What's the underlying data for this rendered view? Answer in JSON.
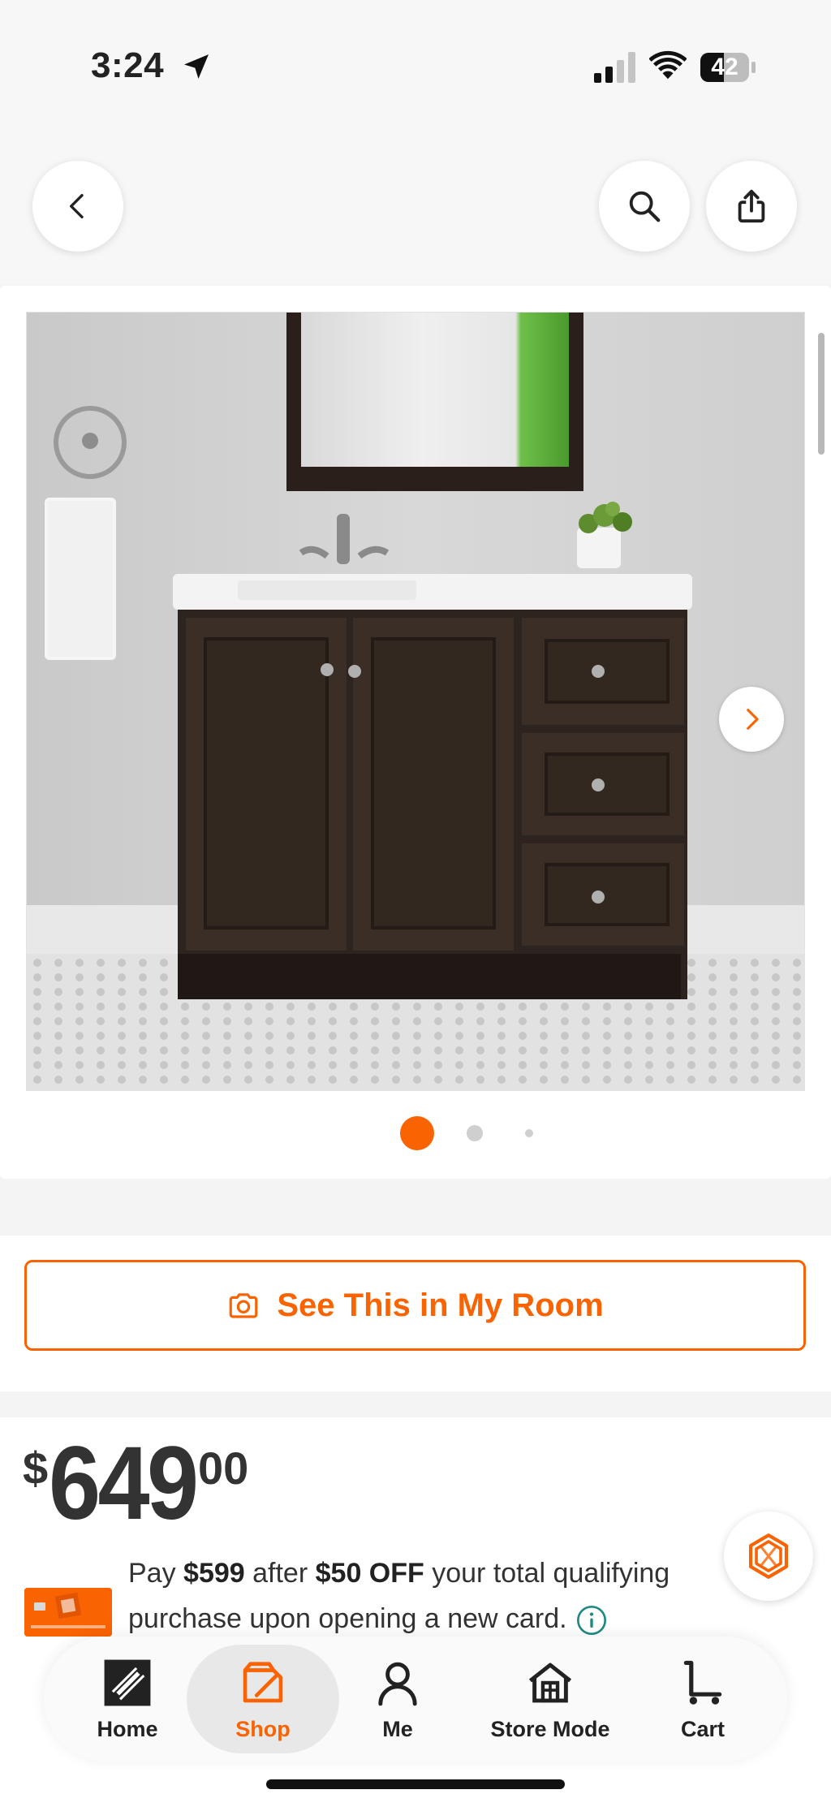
{
  "status_bar": {
    "time": "3:24",
    "battery": "42"
  },
  "top_nav": {
    "back_icon": "chevron-left-icon",
    "search_icon": "search-icon",
    "share_icon": "share-icon"
  },
  "gallery": {
    "image_alt": "bathroom-vanity-photo",
    "dot_count": 3,
    "active_dot": 1
  },
  "room_button": {
    "label": "See This in My Room",
    "icon": "camera-icon"
  },
  "price": {
    "currency": "$",
    "dollars": "649",
    "cents": "00"
  },
  "promo": {
    "pre": "Pay ",
    "after_price": "$599",
    "mid": " after ",
    "discount": "$50 OFF",
    "rest": " your total qualifying purchase upon opening a new card."
  },
  "bottom_nav": {
    "items": [
      {
        "label": "Home",
        "icon": "home-depot-logo-icon"
      },
      {
        "label": "Shop",
        "icon": "shop-icon"
      },
      {
        "label": "Me",
        "icon": "person-icon"
      },
      {
        "label": "Store Mode",
        "icon": "store-icon"
      },
      {
        "label": "Cart",
        "icon": "cart-icon"
      }
    ],
    "active": "Shop"
  },
  "colors": {
    "brand": "#f96302",
    "text": "#222222",
    "background": "#f4f4f4"
  }
}
